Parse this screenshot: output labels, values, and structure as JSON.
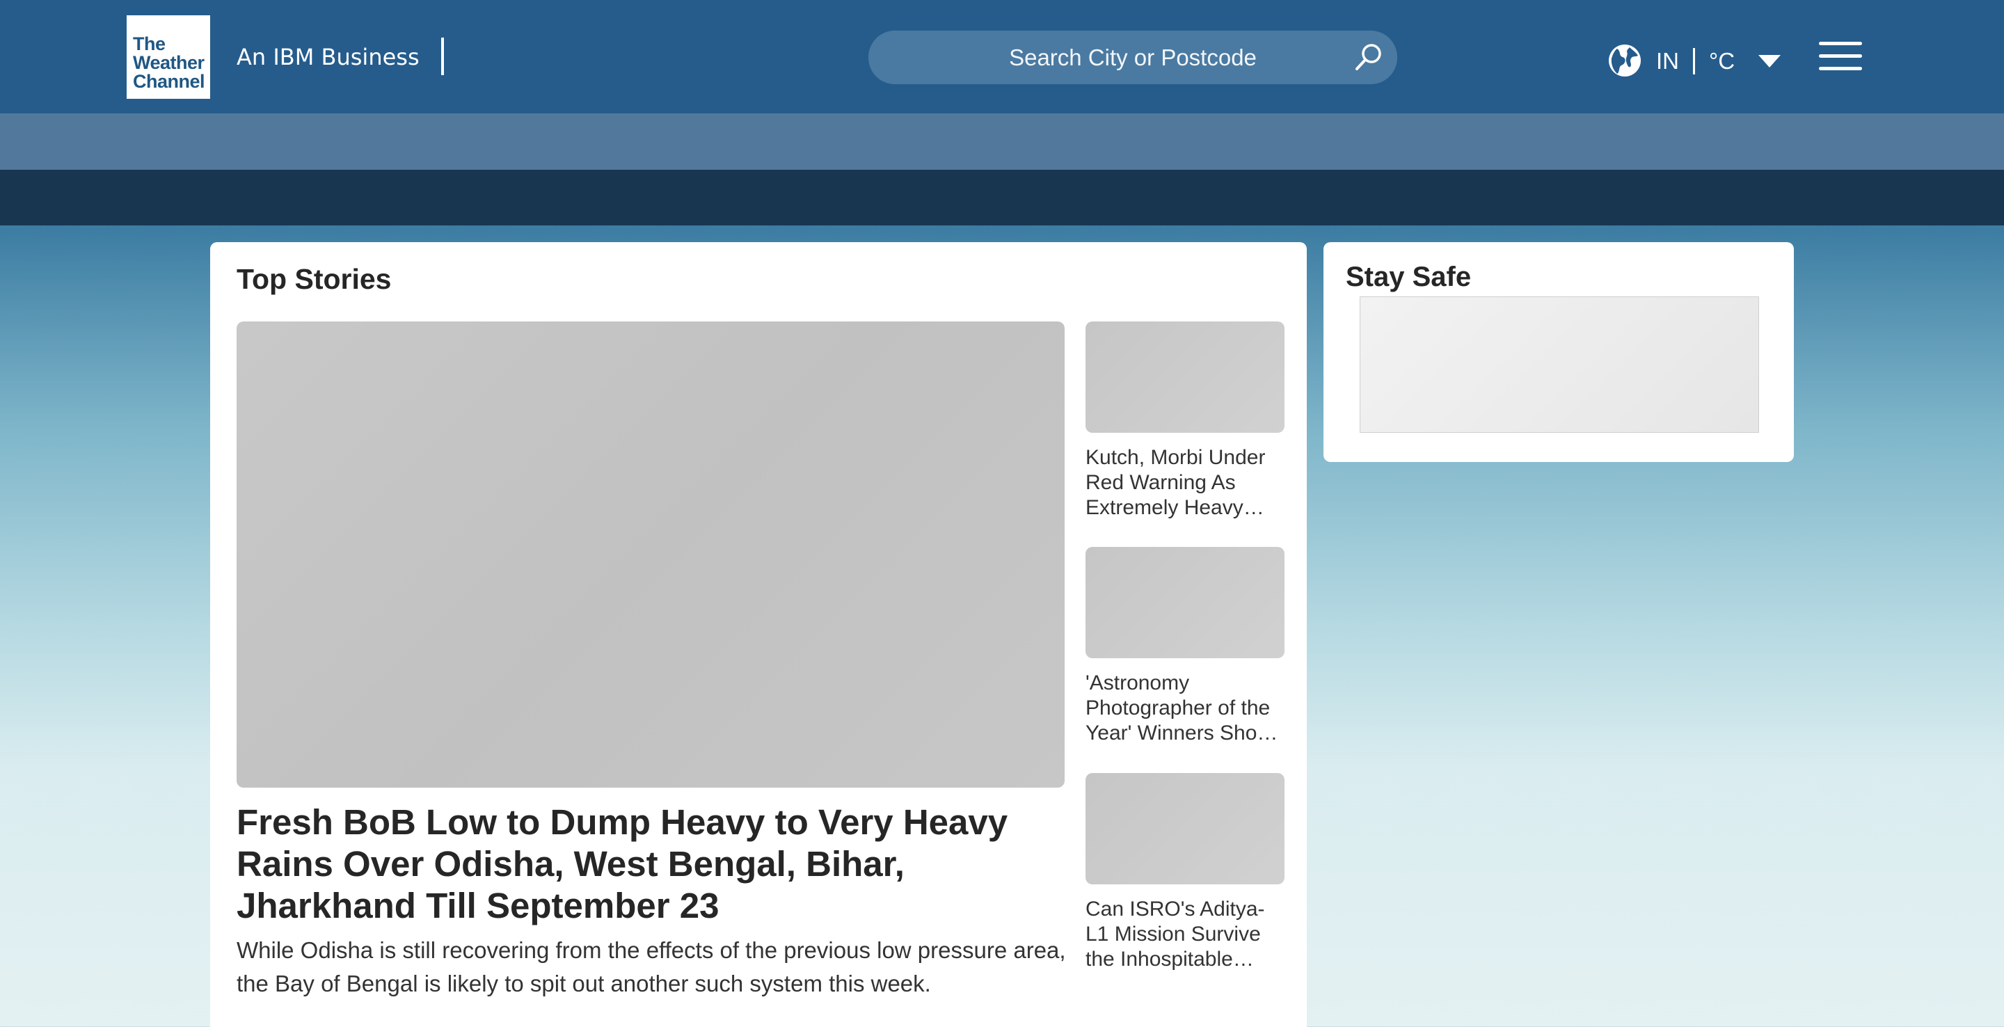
{
  "header": {
    "logo_lines": [
      "The",
      "Weather",
      "Channel"
    ],
    "tagline": "An IBM Business",
    "search_placeholder": "Search City or Postcode",
    "region": "IN",
    "unit": "°C"
  },
  "top_stories": {
    "title": "Top Stories",
    "lead": {
      "headline": "Fresh BoB Low to Dump Heavy to Very Heavy Rains Over Odisha, West Bengal, Bihar, Jharkhand Till September 23",
      "summary": "While Odisha is still recovering from the effects of the previous low pressure area, the Bay of Bengal is likely to spit out another such system this week."
    },
    "side_stories": [
      {
        "title": "Kutch, Morbi Under Red Warning As Extremely Heavy…"
      },
      {
        "title": "'Astronomy Photographer of the Year' Winners Sho…"
      },
      {
        "title": "Can ISRO's Aditya-L1 Mission Survive the Inhospitable…"
      }
    ]
  },
  "stay_safe": {
    "title": "Stay Safe"
  }
}
